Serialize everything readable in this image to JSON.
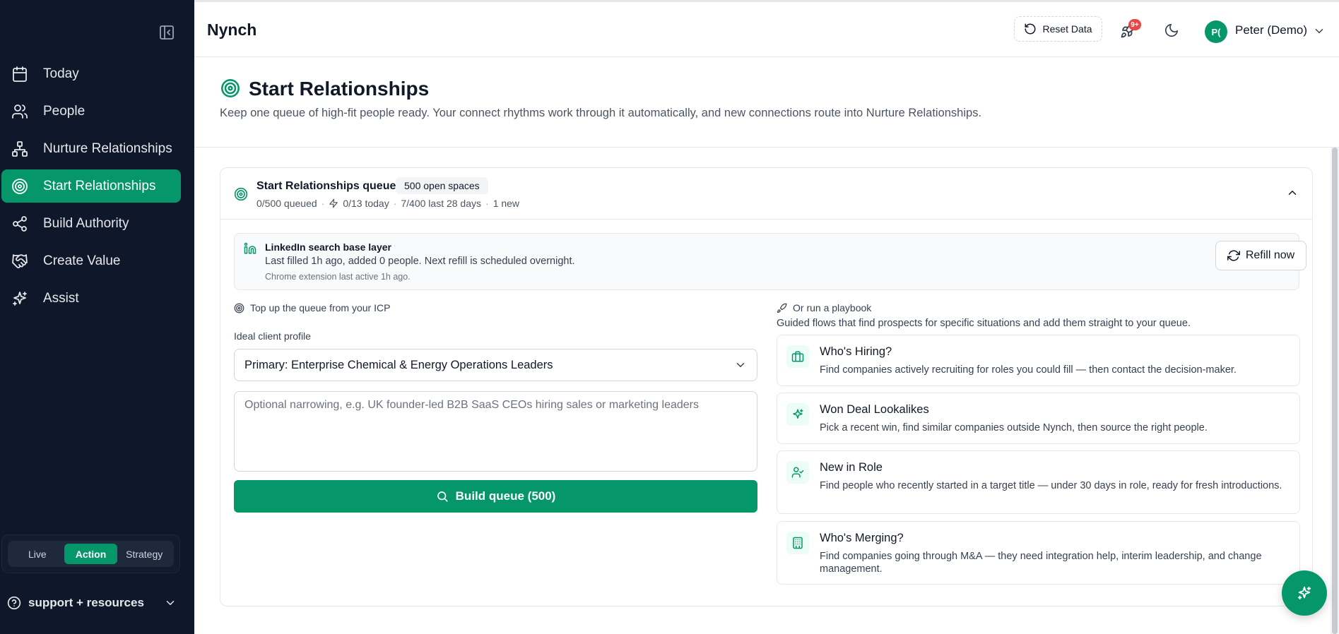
{
  "app": {
    "title": "Nynch"
  },
  "sidebar": {
    "items": [
      {
        "label": "Today",
        "icon": "calendar-icon"
      },
      {
        "label": "People",
        "icon": "users-icon"
      },
      {
        "label": "Nurture Relationships",
        "icon": "network-icon"
      },
      {
        "label": "Start Relationships",
        "icon": "target-icon",
        "active": true
      },
      {
        "label": "Build Authority",
        "icon": "share-icon"
      },
      {
        "label": "Create Value",
        "icon": "handshake-icon"
      },
      {
        "label": "Assist",
        "icon": "sparkles-icon"
      }
    ],
    "modes": [
      "Live",
      "Action",
      "Strategy"
    ],
    "active_mode": "Action",
    "support_label": "support + resources"
  },
  "header": {
    "reset_label": "Reset Data",
    "notif_badge": "9+",
    "avatar_initials": "P(",
    "user_name": "Peter (Demo)"
  },
  "page": {
    "title": "Start Relationships",
    "description": "Keep one queue of high-fit people ready. Your connect rhythms work through it automatically, and new connections route into Nurture Relationships."
  },
  "queue": {
    "title": "Start Relationships queue",
    "pill": "500 open spaces",
    "stat_queued": "0/500 queued",
    "stat_today": "0/13 today",
    "stat_28d": "7/400 last 28 days",
    "stat_new": "1 new",
    "linkedin": {
      "title": "LinkedIn search base layer",
      "subtitle": "Last filled 1h ago, added 0 people. Next refill is scheduled overnight.",
      "note": "Chrome extension last active 1h ago.",
      "refill_label": "Refill now"
    },
    "icp": {
      "section_label": "Top up the queue from your ICP",
      "field_label": "Ideal client profile",
      "selected": "Primary: Enterprise Chemical & Energy Operations Leaders",
      "narrow_placeholder": "Optional narrowing, e.g. UK founder-led B2B SaaS CEOs hiring sales or marketing leaders",
      "build_label": "Build queue (500)"
    },
    "playbook": {
      "section_label": "Or run a playbook",
      "description": "Guided flows that find prospects for specific situations and add them straight to your queue.",
      "items": [
        {
          "title": "Who's Hiring?",
          "desc": "Find companies actively recruiting for roles you could fill — then contact the decision-maker.",
          "icon": "briefcase-icon"
        },
        {
          "title": "Won Deal Lookalikes",
          "desc": "Pick a recent win, find similar companies outside Nynch, then source the right people.",
          "icon": "sparkles-icon"
        },
        {
          "title": "New in Role",
          "desc": "Find people who recently started in a target title — under 30 days in role, ready for fresh introductions.",
          "icon": "user-check-icon"
        },
        {
          "title": "Who's Merging?",
          "desc": "Find companies going through M&A — they need integration help, interim leadership, and change management.",
          "icon": "building-icon"
        }
      ]
    }
  },
  "colors": {
    "accent": "#059669",
    "sidebar_bg": "#0f172a",
    "badge": "#ef4444"
  }
}
